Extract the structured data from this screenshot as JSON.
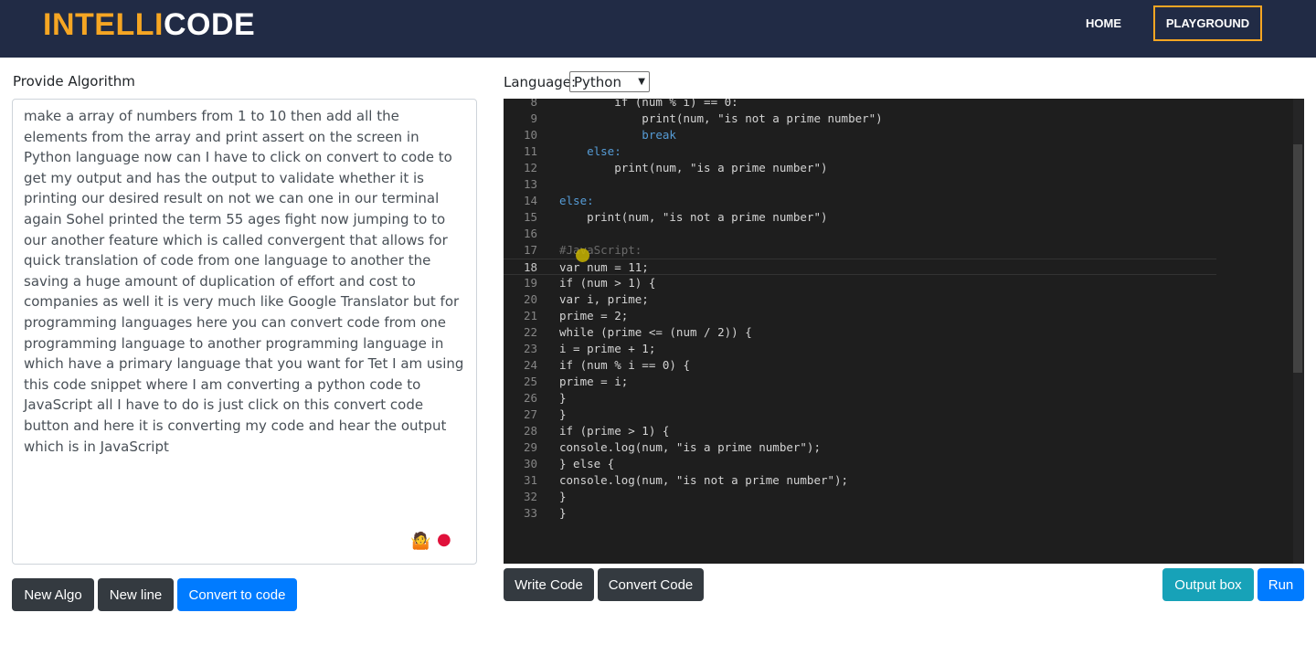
{
  "brand": {
    "part1": "INTELLI",
    "part2": "CODE"
  },
  "nav": {
    "home": "HOME",
    "playground": "PLAYGROUND"
  },
  "left": {
    "label": "Provide Algorithm",
    "text": "make a array of numbers from 1 to 10 then add all the elements from the array and print assert on the screen in Python language now can I have to click on convert to code to get my output and has the output to validate whether it is printing our desired result on not we can one in our terminal again Sohel printed the term 55 ages fight now jumping to to our another feature which is called convergent that allows for quick translation of code from one language to another the saving a huge amount of duplication of effort and cost to companies as well it is very much like Google Translator but for programming languages here you can convert code from one programming language to another programming language in which have a primary language that you want for Tet I am using this code snippet where I am converting a python code to JavaScript all I have to do is just click on this convert code button and here it is converting my code and hear the output which is in JavaScript",
    "buttons": {
      "new_algo": "New Algo",
      "new_line": "New line",
      "convert": "Convert to code"
    }
  },
  "right": {
    "language_label": "Language:",
    "language": "Python",
    "buttons": {
      "write": "Write Code",
      "convert": "Convert Code",
      "output": "Output box",
      "run": "Run"
    },
    "current_line": 18,
    "lines": [
      {
        "n": "8",
        "t": "        if (num % i) == 0:"
      },
      {
        "n": "9",
        "t": "            print(num, \"is not a prime number\")"
      },
      {
        "n": "10",
        "t": "            break"
      },
      {
        "n": "11",
        "t": "    else:"
      },
      {
        "n": "12",
        "t": "        print(num, \"is a prime number\")"
      },
      {
        "n": "13",
        "t": ""
      },
      {
        "n": "14",
        "t": "else:"
      },
      {
        "n": "15",
        "t": "    print(num, \"is not a prime number\")"
      },
      {
        "n": "16",
        "t": ""
      },
      {
        "n": "17",
        "t": "#JavaScript:"
      },
      {
        "n": "18",
        "t": "var num = 11;"
      },
      {
        "n": "19",
        "t": "if (num > 1) {"
      },
      {
        "n": "20",
        "t": "var i, prime;"
      },
      {
        "n": "21",
        "t": "prime = 2;"
      },
      {
        "n": "22",
        "t": "while (prime <= (num / 2)) {"
      },
      {
        "n": "23",
        "t": "i = prime + 1;"
      },
      {
        "n": "24",
        "t": "if (num % i == 0) {"
      },
      {
        "n": "25",
        "t": "prime = i;"
      },
      {
        "n": "26",
        "t": "}"
      },
      {
        "n": "27",
        "t": "}"
      },
      {
        "n": "28",
        "t": "if (prime > 1) {"
      },
      {
        "n": "29",
        "t": "console.log(num, \"is a prime number\");"
      },
      {
        "n": "30",
        "t": "} else {"
      },
      {
        "n": "31",
        "t": "console.log(num, \"is not a prime number\");"
      },
      {
        "n": "32",
        "t": "}"
      },
      {
        "n": "33",
        "t": "}"
      }
    ]
  },
  "colors": {
    "nav": "#212b45",
    "accent": "#f6a623",
    "primary": "#007bff",
    "dark": "#343a40",
    "info": "#17a2b8",
    "editor_bg": "#1e1e1e"
  }
}
